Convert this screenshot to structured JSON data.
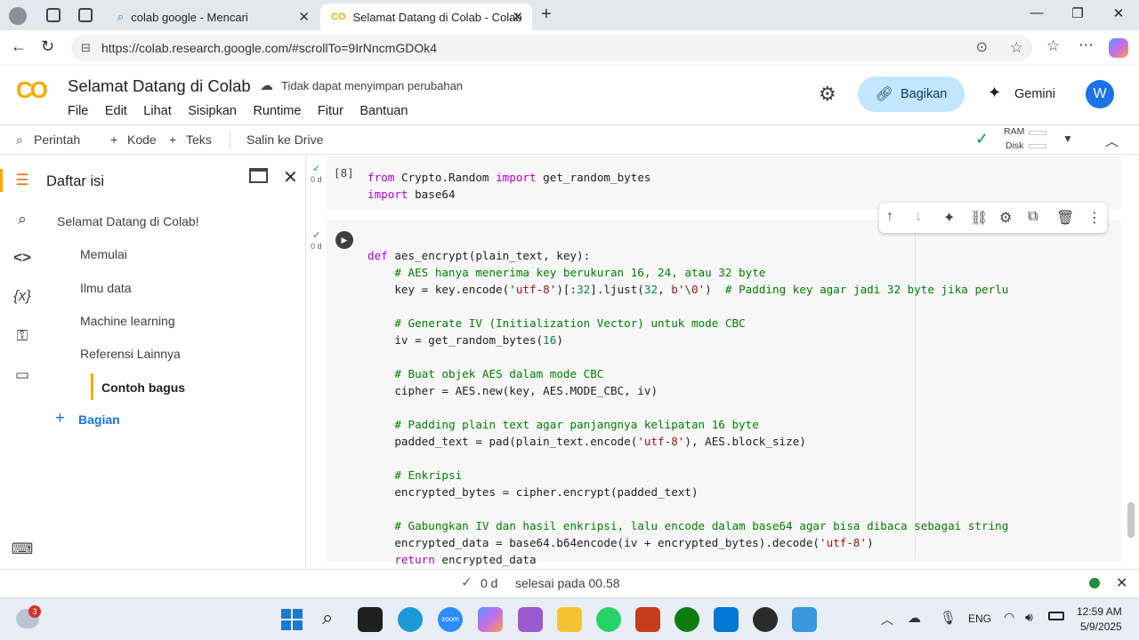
{
  "browser": {
    "tabs": [
      {
        "label": "colab google - Mencari",
        "active": false
      },
      {
        "label": "Selamat Datang di Colab - Colab",
        "active": true
      }
    ],
    "new_tab": "+",
    "url": "https://colab.research.google.com/#scrollTo=9IrNncmGDOk4"
  },
  "colab": {
    "logo": "CO",
    "title": "Selamat Datang di Colab",
    "save_status": "Tidak dapat menyimpan perubahan",
    "menu": [
      "File",
      "Edit",
      "Lihat",
      "Sisipkan",
      "Runtime",
      "Fitur",
      "Bantuan"
    ],
    "share_label": "Bagikan",
    "gemini_label": "Gemini",
    "avatar_letter": "W"
  },
  "toolbar": {
    "command": "Perintah",
    "add_code": "Kode",
    "add_text": "Teks",
    "copy_drive": "Salin ke Drive",
    "ram_label": "RAM",
    "disk_label": "Disk"
  },
  "toc": {
    "title": "Daftar isi",
    "items": [
      {
        "label": "Selamat Datang di Colab!",
        "level": 1
      },
      {
        "label": "Memulai",
        "level": 2
      },
      {
        "label": "Ilmu data",
        "level": 2
      },
      {
        "label": "Machine learning",
        "level": 2
      },
      {
        "label": "Referensi Lainnya",
        "level": 2
      },
      {
        "label": "Contoh bagus",
        "level": 3,
        "active": true
      }
    ],
    "add_section": "Bagian"
  },
  "cells": {
    "cell1": {
      "exec_count": "[8]",
      "time": "0 d",
      "lines": [
        "from Crypto.Random import get_random_bytes",
        "import base64"
      ]
    },
    "cell2": {
      "time": "0 d",
      "lines": [
        "def aes_encrypt(plain_text, key):",
        "    # AES hanya menerima key berukuran 16, 24, atau 32 byte",
        "    key = key.encode('utf-8')[:32].ljust(32, b'\\0')  # Padding key agar jadi 32 byte jika perlu",
        "",
        "    # Generate IV (Initialization Vector) untuk mode CBC",
        "    iv = get_random_bytes(16)",
        "",
        "    # Buat objek AES dalam mode CBC",
        "    cipher = AES.new(key, AES.MODE_CBC, iv)",
        "",
        "    # Padding plain text agar panjangnya kelipatan 16 byte",
        "    padded_text = pad(plain_text.encode('utf-8'), AES.block_size)",
        "",
        "    # Enkripsi",
        "    encrypted_bytes = cipher.encrypt(padded_text)",
        "",
        "    # Gabungkan IV dan hasil enkripsi, lalu encode dalam base64 agar bisa dibaca sebagai string",
        "    encrypted_data = base64.b64encode(iv + encrypted_bytes).decode('utf-8')",
        "    return encrypted_data"
      ]
    }
  },
  "statusbar": {
    "check": "✓",
    "elapsed": "0 d",
    "finished": "selesai pada 00.58"
  },
  "taskbar": {
    "notification_badge": "3",
    "language": "ENG",
    "time": "12:59 AM",
    "date": "5/9/2025",
    "zoom_label": "zoom"
  },
  "colors": {
    "accent_share": "#c2e7ff",
    "avatar": "#1a73e8",
    "keyword": "#af00db",
    "comment": "#008000",
    "string": "#a31515",
    "toc_active_bar": "#f9ab00",
    "status_dot": "#1e8e3e"
  }
}
